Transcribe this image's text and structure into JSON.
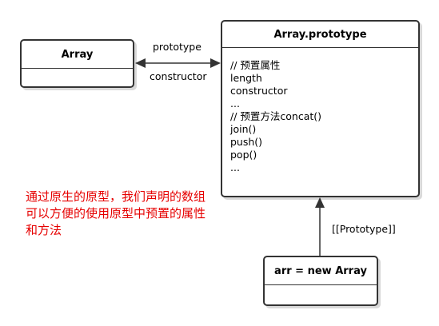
{
  "array_box": {
    "title": "Array"
  },
  "prototype_box": {
    "title": "Array.prototype",
    "lines": [
      "// 预置属性",
      "length",
      "constructor",
      "...",
      "// 预置方法concat()",
      "join()",
      "push()",
      "pop()",
      "..."
    ]
  },
  "instance_box": {
    "title": "arr = new Array"
  },
  "edges": {
    "prototype_label": "prototype",
    "constructor_label": "constructor",
    "proto_chain_label": "[[Prototype]]"
  },
  "note": {
    "text": "通过原生的原型，我们声明的数组可以方便的使用原型中预置的属性和方法",
    "color": "#e60000"
  }
}
